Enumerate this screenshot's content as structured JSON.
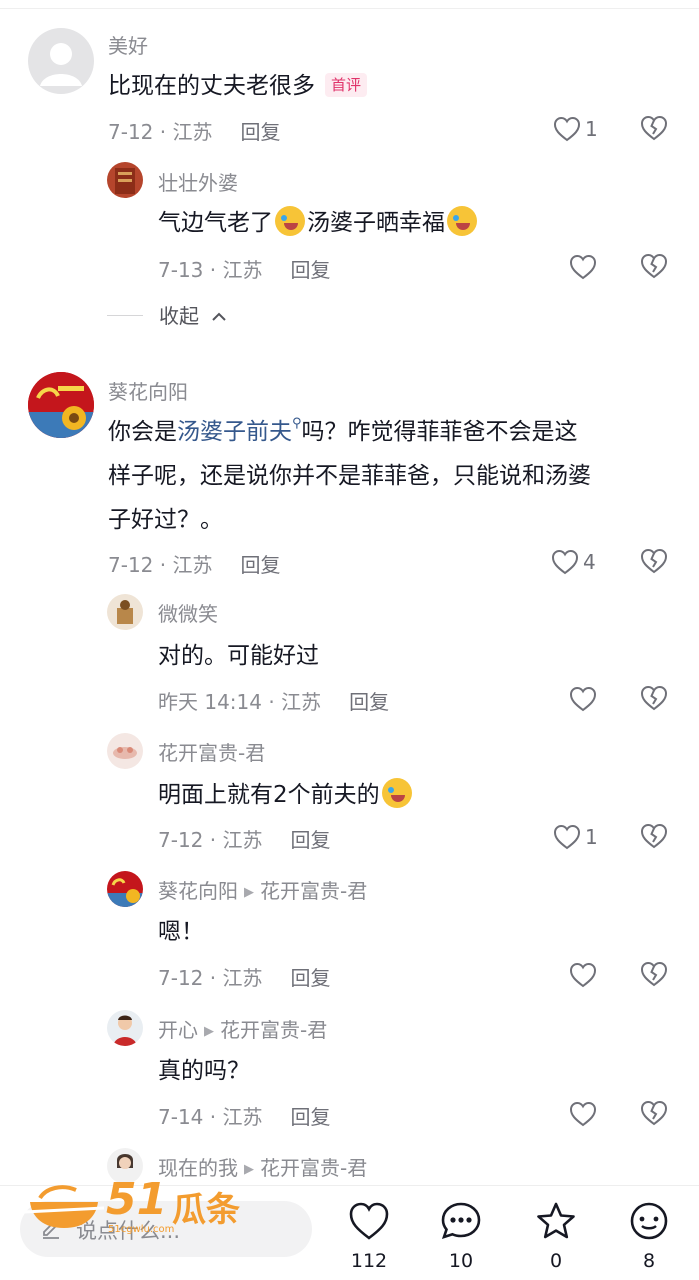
{
  "comments": [
    {
      "user": "美好",
      "text": "比现在的丈夫老很多",
      "tag": "首评",
      "time": "7-12 · 江苏",
      "reply": "回复",
      "likes": "1"
    },
    {
      "user": "壮壮外婆",
      "text_a": "气边气老了",
      "text_b": "汤婆子晒幸福",
      "time": "7-13 · 江苏",
      "reply": "回复"
    },
    {
      "user": "葵花向阳",
      "line1_a": "你会是",
      "line1_link": "汤婆子前夫",
      "line1_b": "吗？咋觉得菲菲爸不会是这",
      "line2": "样子呢，还是说你并不是菲菲爸，只能说和汤婆",
      "line3": "子好过？。",
      "time": "7-12 · 江苏",
      "reply": "回复",
      "likes": "4"
    },
    {
      "user": "微微笑",
      "text": "对的。可能好过",
      "time": "昨天 14:14 · 江苏",
      "reply": "回复"
    },
    {
      "user": "花开富贵-君",
      "text": "明面上就有2个前夫的",
      "time": "7-12 · 江苏",
      "reply": "回复",
      "likes": "1"
    },
    {
      "user": "葵花向阳",
      "reply_to": "花开富贵-君",
      "text": "嗯！",
      "time": "7-12 · 江苏",
      "reply": "回复"
    },
    {
      "user": "开心",
      "reply_to": "花开富贵-君",
      "text": "真的吗？",
      "time": "7-14 · 江苏",
      "reply": "回复"
    },
    {
      "user": "现在的我",
      "reply_to": "花开富贵-君"
    }
  ],
  "collapse_label": "收起",
  "bottom": {
    "input_placeholder": "说点什么...",
    "like_count": "112",
    "comment_count": "10",
    "star_count": "0",
    "share_count": "8"
  },
  "watermark": {
    "brand_num": "51",
    "brand_text": "瓜条",
    "sub": "51cgwlu.com"
  },
  "colors": {
    "text": "#161823",
    "meta": "#8a8b91",
    "link": "#35588c",
    "tag": "#e0336a",
    "watermark": "#f39c2f"
  }
}
